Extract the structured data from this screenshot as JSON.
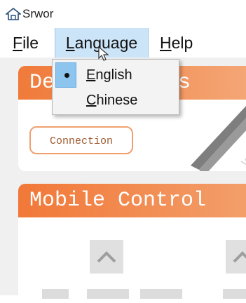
{
  "window": {
    "title": "Srwor"
  },
  "menubar": {
    "items": [
      "File",
      "Language",
      "Help"
    ]
  },
  "language_menu": {
    "items": [
      "English",
      "Chinese"
    ],
    "selected": "English"
  },
  "panels": {
    "device": {
      "title": "De",
      "title_suffix": "cus"
    },
    "mobile": {
      "title": "Mobile Control"
    }
  },
  "buttons": {
    "connection": "Connection"
  },
  "colors": {
    "accent": "#f07a3a",
    "menu_highlight": "#cce4f7",
    "check_highlight": "#8ec5ee"
  }
}
